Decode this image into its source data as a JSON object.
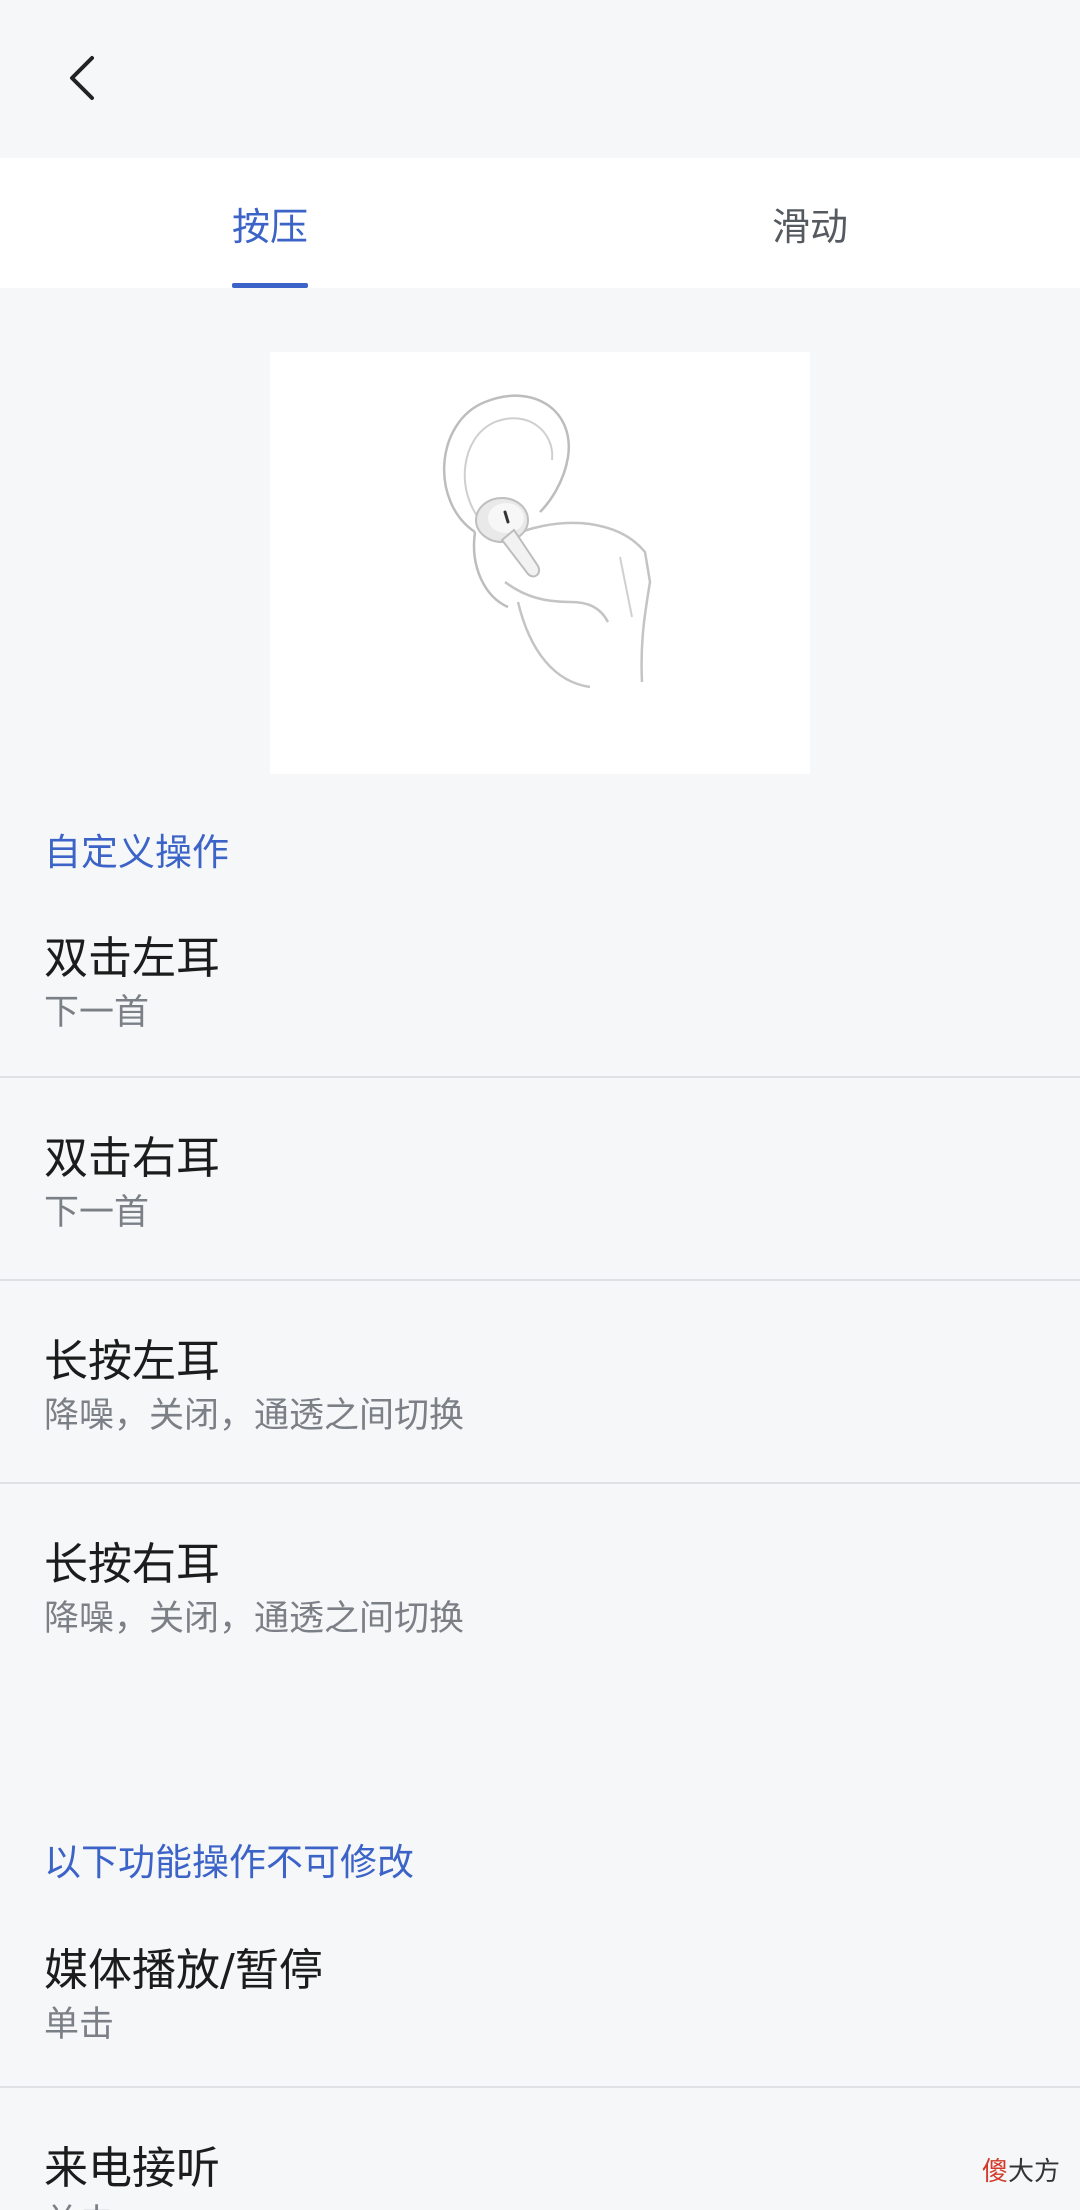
{
  "header": {
    "back_icon": "chevron-left-icon"
  },
  "tabs": [
    {
      "label": "按压",
      "active": true
    },
    {
      "label": "滑动",
      "active": false
    }
  ],
  "illustration": {
    "icon": "earbud-press-illustration"
  },
  "sections": {
    "custom": {
      "title": "自定义操作",
      "items": [
        {
          "title": "双击左耳",
          "subtitle": "下一首"
        },
        {
          "title": "双击右耳",
          "subtitle": "下一首"
        },
        {
          "title": "长按左耳",
          "subtitle": "降噪，关闭，通透之间切换"
        },
        {
          "title": "长按右耳",
          "subtitle": "降噪，关闭，通透之间切换"
        }
      ]
    },
    "fixed": {
      "title": "以下功能操作不可修改",
      "items": [
        {
          "title": "媒体播放/暂停",
          "subtitle": "单击"
        },
        {
          "title": "来电接听",
          "subtitle": "单击"
        }
      ]
    }
  },
  "watermark": {
    "part1": "傻",
    "part2": "大方"
  },
  "colors": {
    "accent": "#3c63c7",
    "background": "#f6f7f9",
    "divider": "#dfe1e4"
  }
}
